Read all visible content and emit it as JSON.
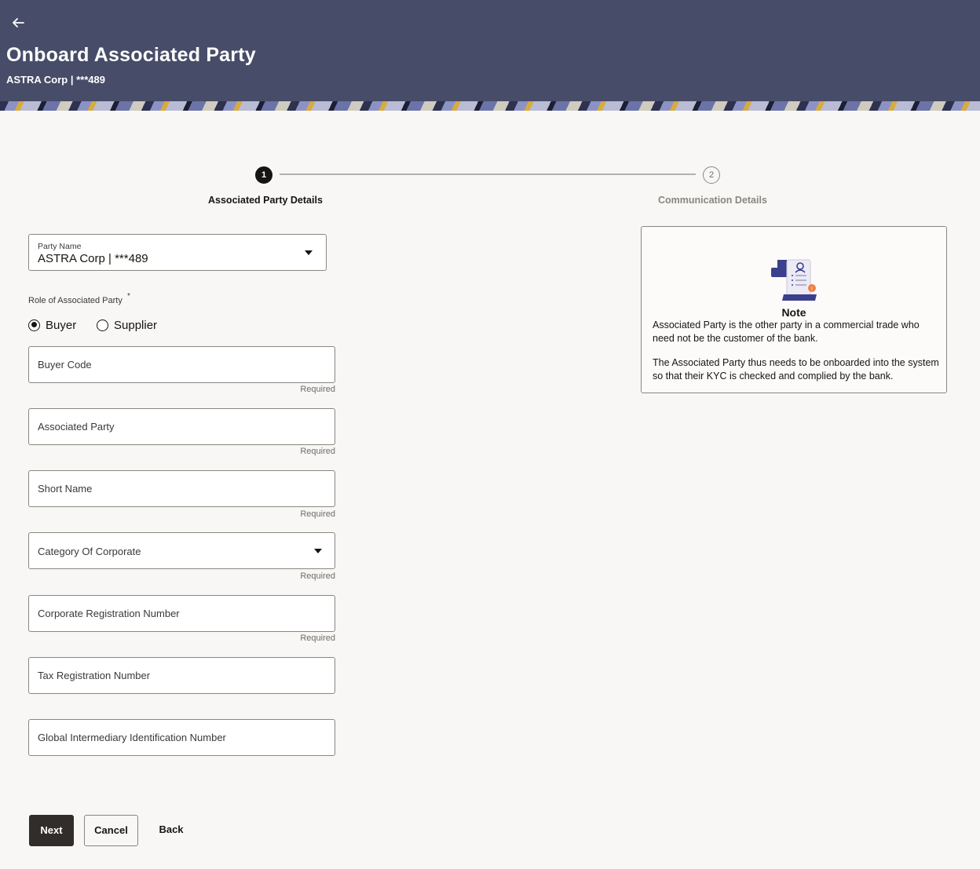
{
  "header": {
    "back_icon": "arrow-left-icon",
    "title": "Onboard Associated Party",
    "subtitle": "ASTRA Corp | ***489"
  },
  "stepper": {
    "steps": [
      {
        "number": "1",
        "label": "Associated Party Details",
        "active": true
      },
      {
        "number": "2",
        "label": "Communication Details",
        "active": false
      }
    ]
  },
  "form": {
    "party_name": {
      "label": "Party Name",
      "value": "ASTRA Corp | ***489"
    },
    "role": {
      "label": "Role of Associated Party",
      "required_mark": "*",
      "options": [
        {
          "label": "Buyer",
          "selected": true
        },
        {
          "label": "Supplier",
          "selected": false
        }
      ]
    },
    "fields": {
      "buyer_code": {
        "placeholder": "Buyer Code",
        "hint": "Required"
      },
      "associated_party": {
        "placeholder": "Associated Party",
        "hint": "Required"
      },
      "short_name": {
        "placeholder": "Short Name",
        "hint": "Required"
      },
      "category": {
        "placeholder": "Category Of Corporate",
        "hint": "Required"
      },
      "corp_reg_number": {
        "placeholder": "Corporate Registration Number",
        "hint": "Required"
      },
      "tax_reg_number": {
        "placeholder": "Tax Registration Number"
      },
      "giin": {
        "placeholder": "Global Intermediary Identification Number"
      }
    }
  },
  "note": {
    "title": "Note",
    "paragraph_1": "Associated Party is the other party in a commercial trade who need not be the customer of the bank.",
    "paragraph_2": "The Associated Party thus needs to be onboarded into the system so that their KYC is checked and complied by the bank."
  },
  "actions": {
    "next_label": "Next",
    "cancel_label": "Cancel",
    "back_label": "Back"
  },
  "colors": {
    "header_bg": "#474c68",
    "primary_button": "#312d2a",
    "page_bg": "#f8f7f5"
  }
}
